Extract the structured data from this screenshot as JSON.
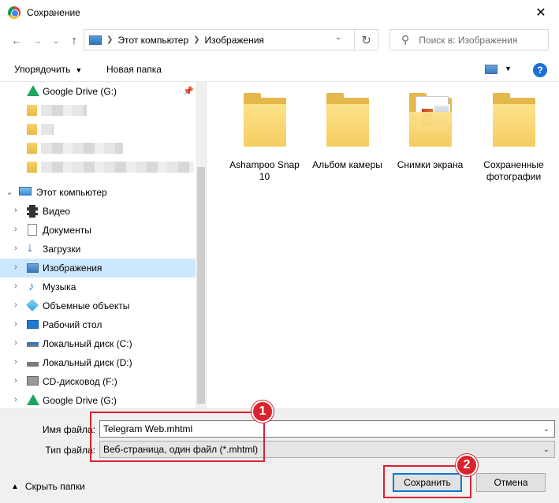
{
  "window": {
    "title": "Сохранение",
    "close_glyph": "✕"
  },
  "nav": {
    "back_glyph": "←",
    "forward_glyph": "→",
    "recent_glyph": "⌄",
    "up_glyph": "↑",
    "breadcrumb": [
      "Этот компьютер",
      "Изображения"
    ],
    "refresh_glyph": "↻",
    "search_placeholder": "Поиск в: Изображения"
  },
  "toolbar": {
    "organize_label": "Упорядочить",
    "new_folder_label": "Новая папка",
    "help_label": "?"
  },
  "tree": {
    "quick_access_top": {
      "label": "Google Drive (G:)"
    },
    "computer": {
      "label": "Этот компьютер"
    },
    "items": [
      {
        "label": "Видео",
        "icon": "video-icon"
      },
      {
        "label": "Документы",
        "icon": "documents-icon"
      },
      {
        "label": "Загрузки",
        "icon": "downloads-icon"
      },
      {
        "label": "Изображения",
        "icon": "pictures-icon",
        "selected": true
      },
      {
        "label": "Музыка",
        "icon": "music-icon"
      },
      {
        "label": "Объемные объекты",
        "icon": "3d-objects-icon"
      },
      {
        "label": "Рабочий стол",
        "icon": "desktop-icon"
      },
      {
        "label": "Локальный диск (C:)",
        "icon": "drive-icon"
      },
      {
        "label": "Локальный диск (D:)",
        "icon": "drive-icon"
      },
      {
        "label": "CD-дисковод (F:)",
        "icon": "cd-drive-icon"
      },
      {
        "label": "Google Drive (G:)",
        "icon": "google-drive-icon"
      }
    ]
  },
  "folders": [
    {
      "label": "Ashampoo Snap 10"
    },
    {
      "label": "Альбом камеры"
    },
    {
      "label": "Снимки экрана"
    },
    {
      "label": "Сохраненные фотографии"
    }
  ],
  "form": {
    "filename_label": "Имя файла:",
    "filename_value": "Telegram Web.mhtml",
    "filetype_label": "Тип файла:",
    "filetype_value": "Веб-страница, один файл (*.mhtml)",
    "hide_folders_label": "Скрыть папки",
    "save_label": "Сохранить",
    "cancel_label": "Отмена"
  },
  "annotations": {
    "badge1": "1",
    "badge2": "2",
    "color": "#d9232e"
  },
  "colors": {
    "selected": "#cce8ff",
    "accent": "#0078d7",
    "folder": "#f5cd60"
  }
}
